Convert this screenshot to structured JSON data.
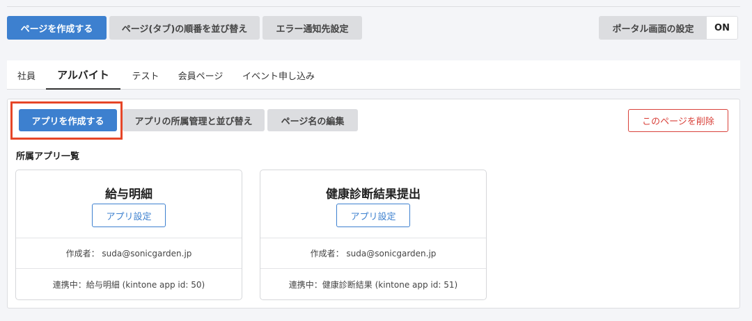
{
  "toolbar": {
    "create_page": "ページを作成する",
    "reorder_pages": "ページ(タブ)の順番を並び替え",
    "error_notify": "エラー通知先設定",
    "portal_settings": "ポータル画面の設定",
    "portal_state": "ON"
  },
  "tabs": [
    {
      "label": "社員"
    },
    {
      "label": "アルバイト"
    },
    {
      "label": "テスト"
    },
    {
      "label": "会員ページ"
    },
    {
      "label": "イベント申し込み"
    }
  ],
  "page_actions": {
    "create_app": "アプリを作成する",
    "manage_apps": "アプリの所属管理と並び替え",
    "edit_page_name": "ページ名の編集",
    "delete_page": "このページを削除"
  },
  "apps_section": {
    "title": "所属アプリ一覧",
    "cards": [
      {
        "name": "給与明細",
        "setting_label": "アプリ設定",
        "author": "作成者： suda@sonicgarden.jp",
        "linked": "連携中：給与明細 (kintone app id: 50)"
      },
      {
        "name": "健康診断結果提出",
        "setting_label": "アプリ設定",
        "author": "作成者： suda@sonicgarden.jp",
        "linked": "連携中：健康診断結果 (kintone app id: 51)"
      }
    ]
  },
  "colors": {
    "primary": "#3d80cf",
    "danger": "#d9413a",
    "highlight": "#e64628"
  }
}
